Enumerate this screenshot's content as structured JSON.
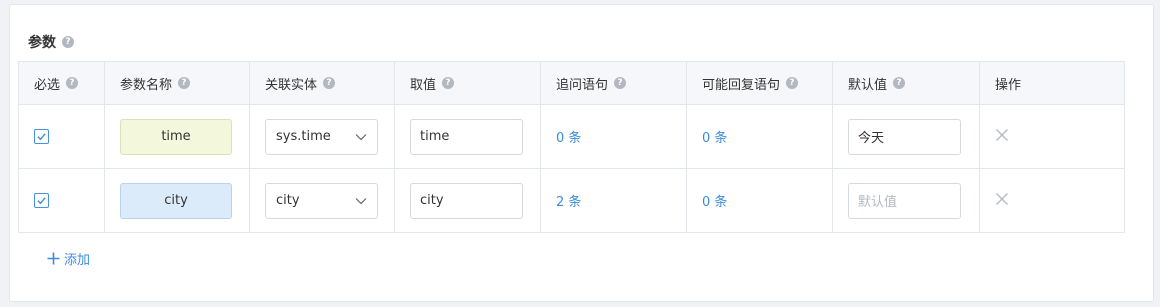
{
  "section": {
    "title": "参数"
  },
  "columns": {
    "required": "必选",
    "param_name": "参数名称",
    "entity": "关联实体",
    "value": "取值",
    "followup": "追问语句",
    "replies": "可能回复语句",
    "default": "默认值",
    "actions": "操作"
  },
  "rows": [
    {
      "required": true,
      "param_name": "time",
      "entity": "sys.time",
      "value": "time",
      "followup": "0 条",
      "replies": "0 条",
      "default_value": "今天",
      "default_placeholder": "默认值"
    },
    {
      "required": true,
      "param_name": "city",
      "entity": "city",
      "value": "city",
      "followup": "2 条",
      "replies": "0 条",
      "default_value": "",
      "default_placeholder": "默认值"
    }
  ],
  "add_label": "添加",
  "colors": {
    "accent": "#3d8bdf",
    "tag_green": "#f3f8dc",
    "tag_blue": "#dcebf9"
  }
}
